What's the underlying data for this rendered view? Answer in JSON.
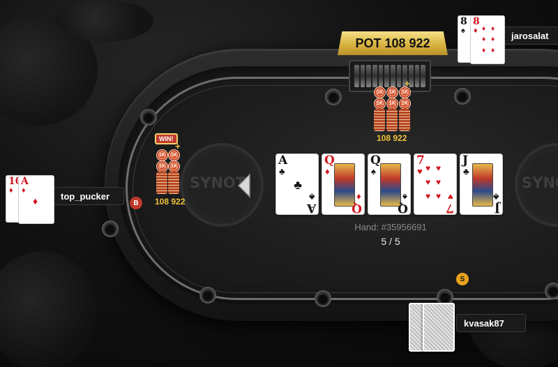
{
  "pot": {
    "label": "POT 108 922",
    "chips_amount": "108 922"
  },
  "chip_denomination": "1K",
  "winner": {
    "badge": "WIN!",
    "amount": "108 922"
  },
  "table_logo": "SYNOT",
  "hand": {
    "id_text": "Hand: #35956691",
    "progress_text": "5 / 5"
  },
  "board": [
    {
      "rank": "A",
      "suit": "♣",
      "color": "black"
    },
    {
      "rank": "Q",
      "suit": "♦",
      "color": "red",
      "face": true
    },
    {
      "rank": "Q",
      "suit": "♠",
      "color": "black",
      "face": true
    },
    {
      "rank": "7",
      "suit": "♥",
      "color": "red"
    },
    {
      "rank": "J",
      "suit": "♣",
      "color": "black",
      "face": true
    }
  ],
  "players": {
    "top_pucker": {
      "name": "top_pucker",
      "button": "B",
      "cards": [
        {
          "rank": "10",
          "suit": "♦"
        },
        {
          "rank": "A",
          "suit": "♦"
        }
      ]
    },
    "jarosalat": {
      "name": "jarosalat",
      "cards": [
        {
          "rank": "8",
          "suit": "♠"
        },
        {
          "rank": "8",
          "suit": "♦"
        }
      ]
    },
    "kvasak87": {
      "name": "kvasak87",
      "button": "S"
    }
  },
  "colors": {
    "gold": "#f2c53d",
    "suit_red": "#d2161e",
    "big_blind": "#c0392b",
    "small_blind": "#e8a21b"
  }
}
